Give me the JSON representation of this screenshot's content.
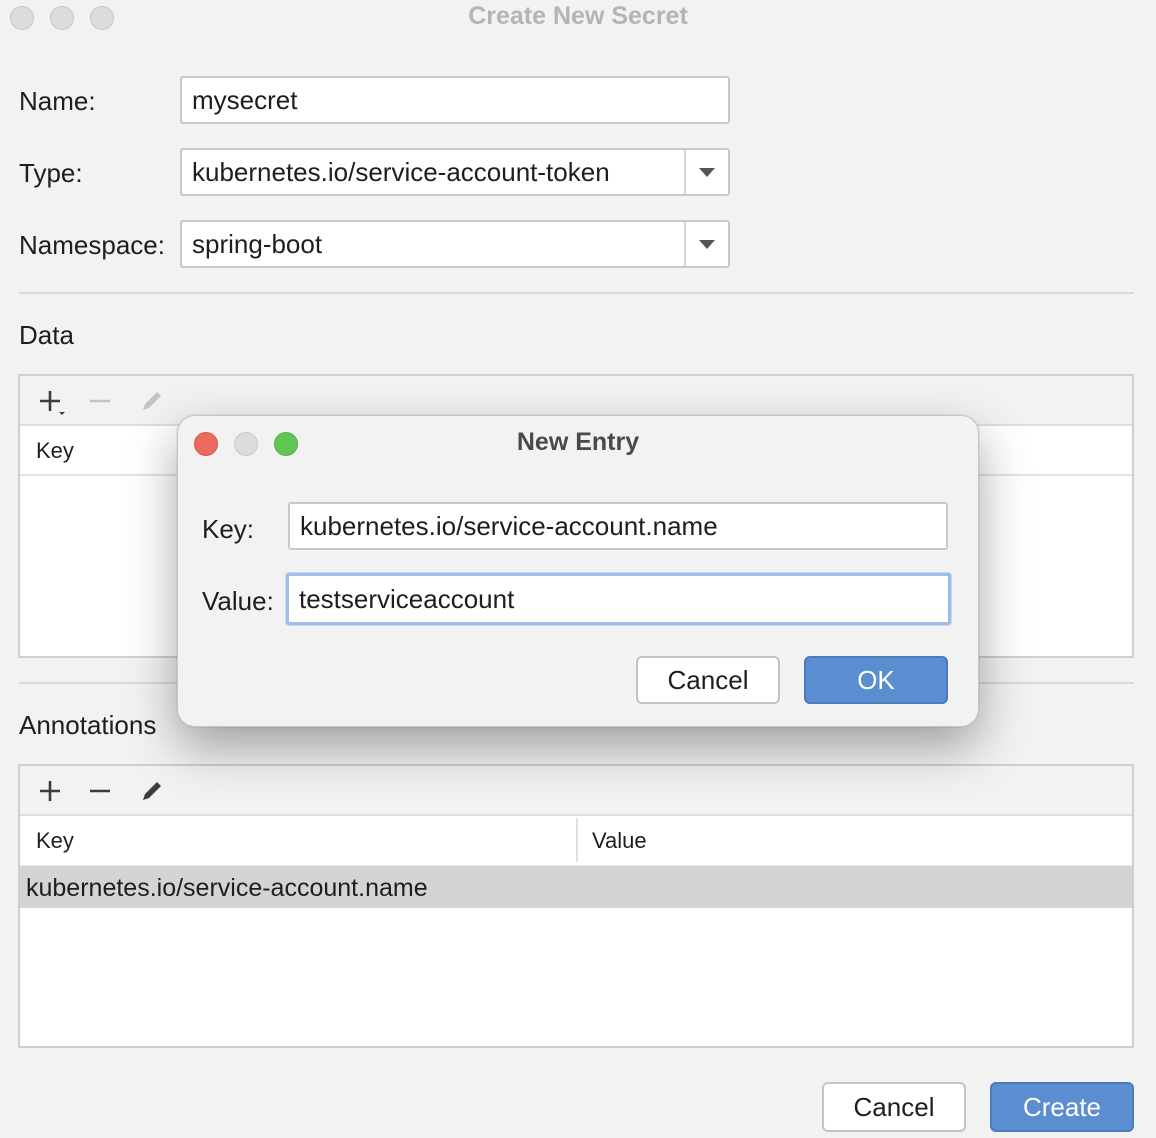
{
  "window": {
    "title": "Create New Secret"
  },
  "form": {
    "name_label": "Name:",
    "name_value": "mysecret",
    "type_label": "Type:",
    "type_value": "kubernetes.io/service-account-token",
    "namespace_label": "Namespace:",
    "namespace_value": "spring-boot"
  },
  "data_section": {
    "title": "Data",
    "columns": [
      "Key"
    ]
  },
  "annotations_section": {
    "title": "Annotations",
    "columns": [
      "Key",
      "Value"
    ],
    "rows": [
      {
        "key": "kubernetes.io/service-account.name",
        "value": ""
      }
    ]
  },
  "dialog": {
    "title": "New Entry",
    "key_label": "Key:",
    "key_value": "kubernetes.io/service-account.name",
    "value_label": "Value:",
    "value_value": "testserviceaccount",
    "cancel_label": "Cancel",
    "ok_label": "OK"
  },
  "footer": {
    "cancel_label": "Cancel",
    "create_label": "Create"
  },
  "colors": {
    "accent": "#5b8ed0",
    "close": "#ec6a5e",
    "zoom": "#61c554",
    "selected_row": "#d4d4d4"
  },
  "icons": [
    "add-icon",
    "remove-icon",
    "edit-icon",
    "dropdown-arrow-icon"
  ]
}
